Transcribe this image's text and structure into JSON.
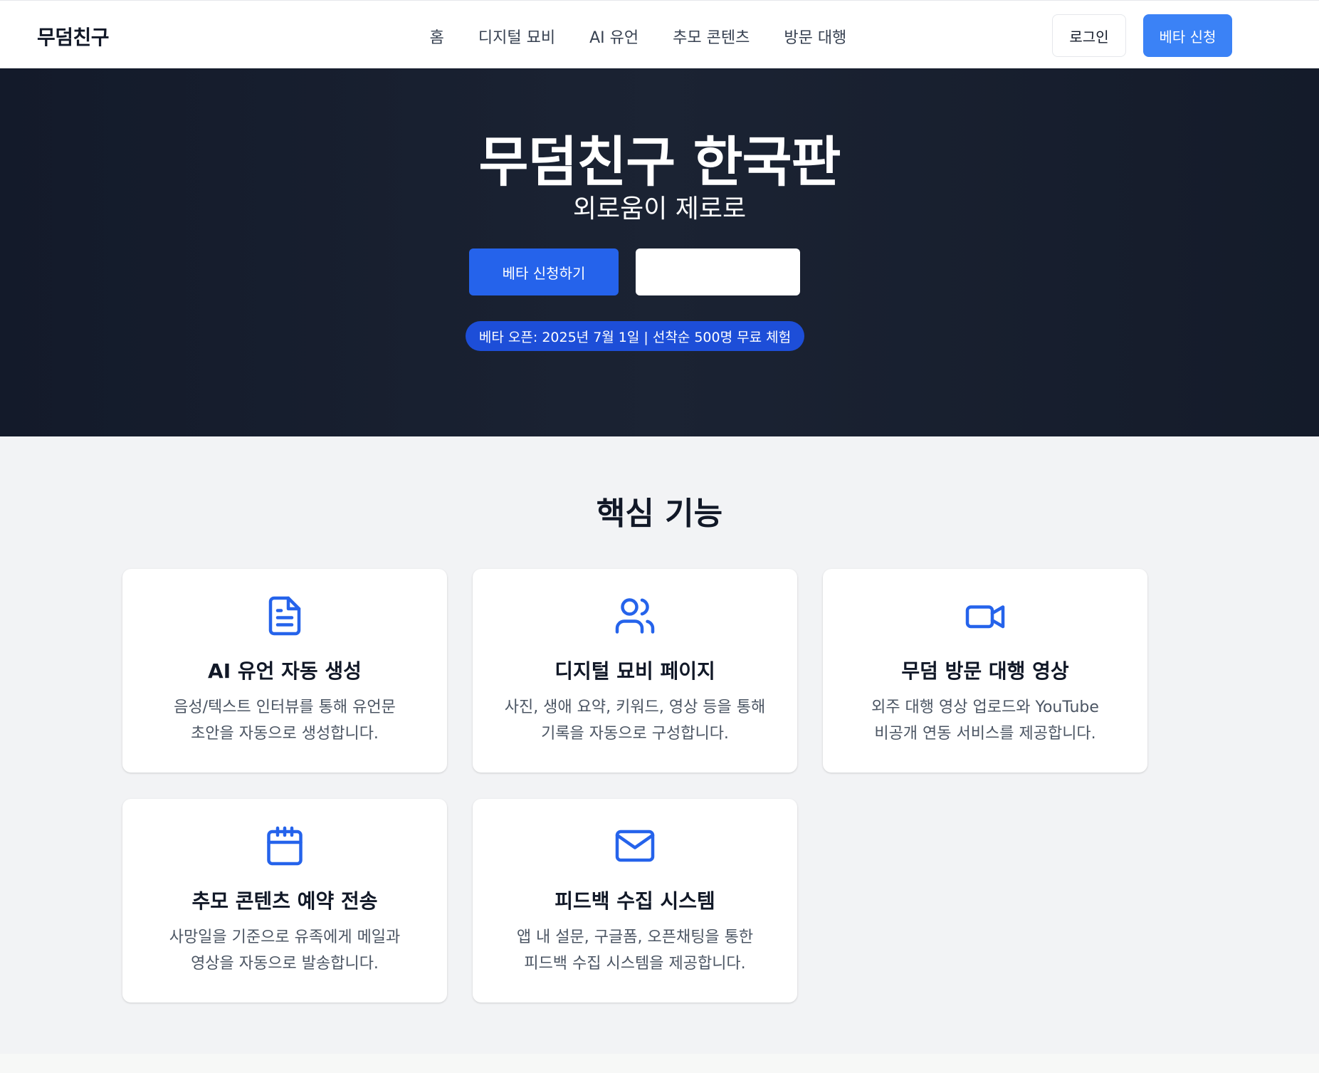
{
  "header": {
    "logo": "무덤친구",
    "nav": [
      "홈",
      "디지털 묘비",
      "AI 유언",
      "추모 콘텐츠",
      "방문 대행"
    ],
    "login_label": "로그인",
    "beta_label": "베타 신청"
  },
  "hero": {
    "title": "무덤친구 한국판",
    "subtitle": "외로움이 제로로",
    "primary_button": "베타 신청하기",
    "secondary_button": "",
    "badge": "베타 오픈: 2025년 7월 1일 | 선착순 500명 무료 체험"
  },
  "features": {
    "title": "핵심 기능",
    "cards": [
      {
        "icon": "document-icon",
        "title": "AI 유언 자동 생성",
        "desc_line1": "음성/텍스트 인터뷰를 통해 유언문",
        "desc_line2": "초안을 자동으로 생성합니다."
      },
      {
        "icon": "users-icon",
        "title": "디지털 묘비 페이지",
        "desc_line1": "사진, 생애 요약, 키워드, 영상 등을 통해",
        "desc_line2": "기록을 자동으로 구성합니다."
      },
      {
        "icon": "video-icon",
        "title": "무덤 방문 대행 영상",
        "desc_line1": "외주 대행 영상 업로드와 YouTube",
        "desc_line2": "비공개 연동 서비스를 제공합니다."
      },
      {
        "icon": "calendar-icon",
        "title": "추모 콘텐츠 예약 전송",
        "desc_line1": "사망일을 기준으로 유족에게 메일과",
        "desc_line2": "영상을 자동으로 발송합니다."
      },
      {
        "icon": "mail-icon",
        "title": "피드백 수집 시스템",
        "desc_line1": "앱 내 설문, 구글폼, 오픈채팅을 통한",
        "desc_line2": "피드백 수집 시스템을 제공합니다."
      }
    ]
  },
  "colors": {
    "accent": "#2563eb",
    "accent_light": "#3b82f6",
    "hero_bg": "#161d2c",
    "section_bg": "#f2f3f5"
  }
}
